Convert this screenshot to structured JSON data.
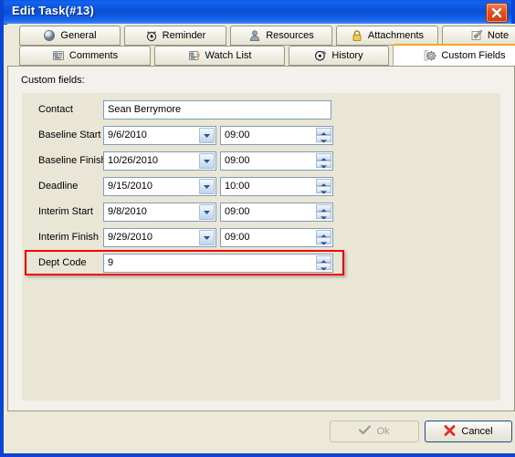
{
  "window": {
    "title": "Edit Task(#13)",
    "close_icon": "close-icon",
    "accent_title_color": "#0a52dc",
    "highlight_color": "#ff0000"
  },
  "tabs": {
    "row1": [
      {
        "label": "General",
        "icon": "sphere-icon",
        "selected": false
      },
      {
        "label": "Reminder",
        "icon": "alarm-clock-icon",
        "selected": false
      },
      {
        "label": "Resources",
        "icon": "person-icon",
        "selected": false
      },
      {
        "label": "Attachments",
        "icon": "padlock-icon",
        "selected": false
      },
      {
        "label": "Note",
        "icon": "pushpin-note-icon",
        "selected": false
      }
    ],
    "row2": [
      {
        "label": "Comments",
        "icon": "comment-card-icon",
        "selected": false
      },
      {
        "label": "Watch List",
        "icon": "watch-list-icon",
        "selected": false
      },
      {
        "label": "History",
        "icon": "clock-icon",
        "selected": false
      },
      {
        "label": "Custom Fields",
        "icon": "gear-icon",
        "selected": true
      }
    ]
  },
  "page": {
    "label": "Custom fields:",
    "rows": [
      {
        "label": "Contact",
        "type": "text",
        "value": "Sean Berrymore"
      },
      {
        "label": "Baseline Start",
        "type": "date-time",
        "date": "9/6/2010",
        "time": "09:00"
      },
      {
        "label": "Baseline Finish",
        "type": "date-time",
        "date": "10/26/2010",
        "time": "09:00"
      },
      {
        "label": "Deadline",
        "type": "date-time",
        "date": "9/15/2010",
        "time": "10:00"
      },
      {
        "label": "Interim Start",
        "type": "date-time",
        "date": "9/8/2010",
        "time": "09:00"
      },
      {
        "label": "Interim Finish",
        "type": "date-time",
        "date": "9/29/2010",
        "time": "09:00"
      },
      {
        "label": "Dept Code",
        "type": "spinner",
        "value": "9",
        "highlighted": true
      }
    ]
  },
  "footer": {
    "ok_label": "Ok",
    "ok_icon": "checkmark-icon",
    "ok_disabled": true,
    "cancel_label": "Cancel",
    "cancel_icon": "red-x-icon"
  }
}
